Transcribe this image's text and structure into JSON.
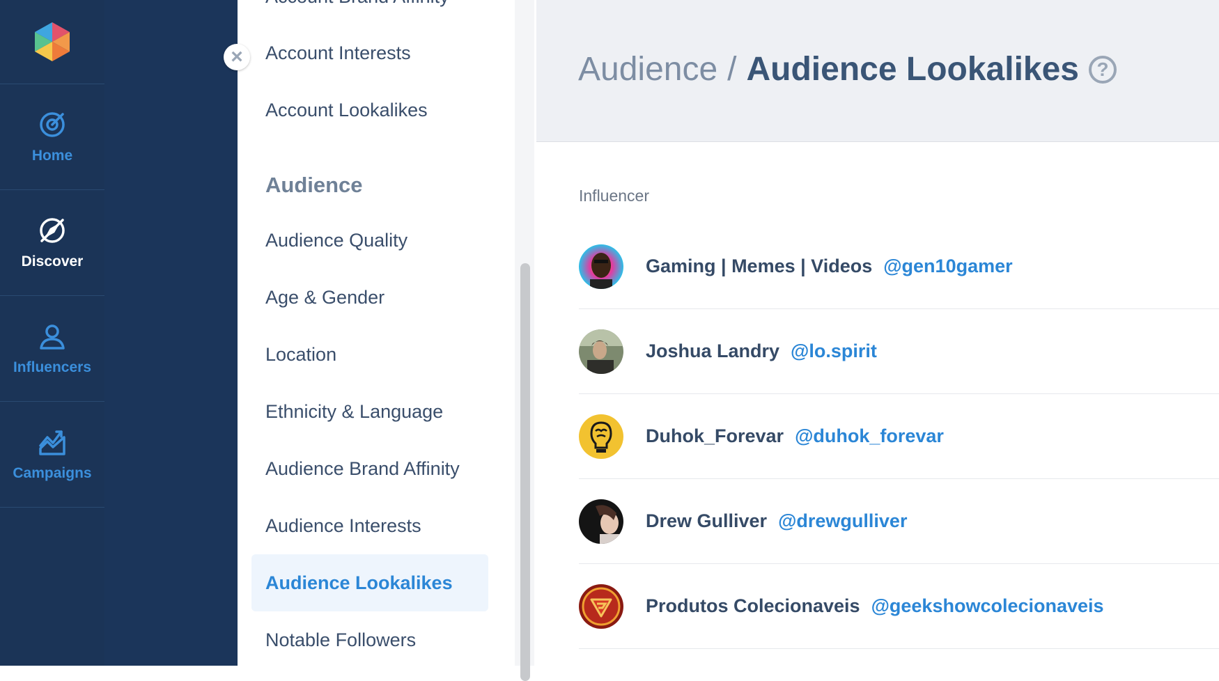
{
  "nav": {
    "items": [
      {
        "id": "home",
        "label": "Home",
        "icon": "target-icon",
        "active": false
      },
      {
        "id": "discover",
        "label": "Discover",
        "icon": "compass-icon",
        "active": true
      },
      {
        "id": "influencers",
        "label": "Influencers",
        "icon": "person-icon",
        "active": false
      },
      {
        "id": "campaigns",
        "label": "Campaigns",
        "icon": "chart-icon",
        "active": false
      }
    ]
  },
  "submenu": {
    "partial_top": "Account Brand Affinity",
    "account_interests": "Account Interests",
    "account_lookalikes": "Account Lookalikes",
    "section_audience": "Audience",
    "audience_quality": "Audience Quality",
    "age_gender": "Age & Gender",
    "location": "Location",
    "ethnicity_language": "Ethnicity & Language",
    "audience_brand_affinity": "Audience Brand Affinity",
    "audience_interests": "Audience Interests",
    "audience_lookalikes": "Audience Lookalikes",
    "notable_followers": "Notable Followers",
    "close_symbol": "×"
  },
  "header": {
    "parent": "Audience",
    "separator": "/",
    "current": "Audience Lookalikes",
    "help_symbol": "?"
  },
  "table": {
    "column_label": "Influencer",
    "rows": [
      {
        "name": "Gaming | Memes | Videos",
        "handle": "@gen10gamer"
      },
      {
        "name": "Joshua Landry",
        "handle": "@lo.spirit"
      },
      {
        "name": "Duhok_Forevar",
        "handle": "@duhok_forevar"
      },
      {
        "name": "Drew Gulliver",
        "handle": "@drewgulliver"
      },
      {
        "name": "Produtos Colecionaveis",
        "handle": "@geekshowcolecionaveis"
      }
    ]
  },
  "colors": {
    "rail": "#1b3457",
    "accent": "#2b86d6",
    "active_bg": "#eef5fd"
  }
}
